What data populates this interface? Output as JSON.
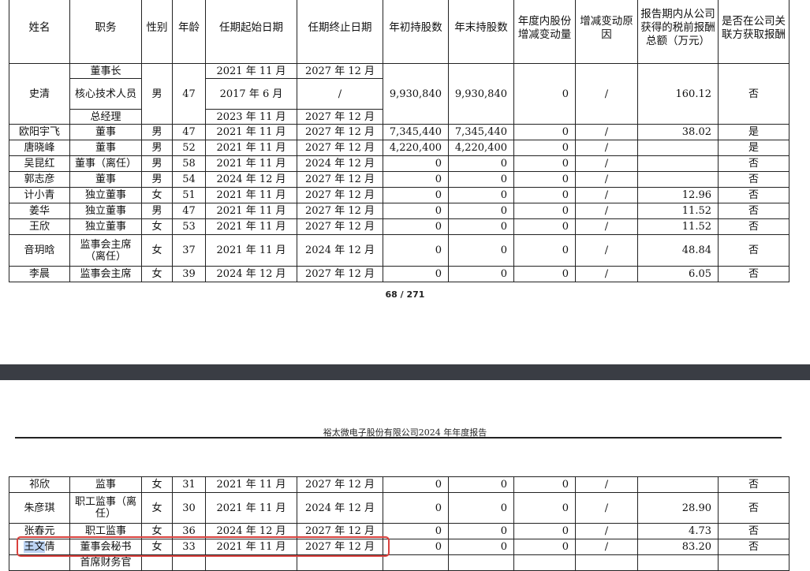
{
  "headers": [
    "姓名",
    "职务",
    "性别",
    "年龄",
    "任期起始日期",
    "任期终止日期",
    "年初持股数",
    "年末持股数",
    "年度内股份增减变动量",
    "增减变动原因",
    "报告期内从公司获得的税前报酬总额（万元）",
    "是否在公司关联方获取报酬"
  ],
  "top_rows": [
    {
      "name": "史清",
      "roles": [
        "董事长",
        "核心技术人员",
        "总经理"
      ],
      "gender": "男",
      "age": "47",
      "starts": [
        "2021 年 11 月",
        "2017 年 6 月",
        "2023 年 11 月"
      ],
      "ends": [
        "2027 年 12 月",
        "/",
        "2027 年 12 月"
      ],
      "begin_shares": "9,930,840",
      "end_shares": "9,930,840",
      "change": "0",
      "reason": "/",
      "pay": "160.12",
      "related": "否"
    },
    {
      "name": "欧阳宇飞",
      "role": "董事",
      "gender": "男",
      "age": "47",
      "start": "2021 年 11 月",
      "end": "2027 年 12 月",
      "begin_shares": "7,345,440",
      "end_shares": "7,345,440",
      "change": "0",
      "reason": "/",
      "pay": "38.02",
      "related": "是"
    },
    {
      "name": "唐晓峰",
      "role": "董事",
      "gender": "男",
      "age": "52",
      "start": "2021 年 11 月",
      "end": "2027 年 12 月",
      "begin_shares": "4,220,400",
      "end_shares": "4,220,400",
      "change": "0",
      "reason": "/",
      "pay": "",
      "related": "是"
    },
    {
      "name": "吴昆红",
      "role": "董事（离任）",
      "gender": "男",
      "age": "58",
      "start": "2021 年 11 月",
      "end": "2024 年 12 月",
      "begin_shares": "0",
      "end_shares": "0",
      "change": "0",
      "reason": "/",
      "pay": "",
      "related": "否"
    },
    {
      "name": "郭志彦",
      "role": "董事",
      "gender": "男",
      "age": "54",
      "start": "2024 年 12 月",
      "end": "2027 年 12 月",
      "begin_shares": "0",
      "end_shares": "0",
      "change": "0",
      "reason": "/",
      "pay": "",
      "related": "否"
    },
    {
      "name": "计小青",
      "role": "独立董事",
      "gender": "女",
      "age": "51",
      "start": "2021 年 11 月",
      "end": "2027 年 12 月",
      "begin_shares": "0",
      "end_shares": "0",
      "change": "0",
      "reason": "/",
      "pay": "12.96",
      "related": "否"
    },
    {
      "name": "姜华",
      "role": "独立董事",
      "gender": "男",
      "age": "47",
      "start": "2021 年 11 月",
      "end": "2027 年 12 月",
      "begin_shares": "0",
      "end_shares": "0",
      "change": "0",
      "reason": "/",
      "pay": "11.52",
      "related": "否"
    },
    {
      "name": "王欣",
      "role": "独立董事",
      "gender": "女",
      "age": "53",
      "start": "2021 年 11 月",
      "end": "2027 年 12 月",
      "begin_shares": "0",
      "end_shares": "0",
      "change": "0",
      "reason": "/",
      "pay": "11.52",
      "related": "否"
    },
    {
      "name": "音玥晗",
      "role": "监事会主席（离任）",
      "gender": "女",
      "age": "37",
      "start": "2021 年 11 月",
      "end": "2024 年 12 月",
      "begin_shares": "0",
      "end_shares": "0",
      "change": "0",
      "reason": "/",
      "pay": "48.84",
      "related": "否"
    },
    {
      "name": "李晨",
      "role": "监事会主席",
      "gender": "女",
      "age": "39",
      "start": "2024 年 12 月",
      "end": "2027 年 12 月",
      "begin_shares": "0",
      "end_shares": "0",
      "change": "0",
      "reason": "/",
      "pay": "6.05",
      "related": "否"
    }
  ],
  "page_number": "68 / 271",
  "report_header": "裕太微电子股份有限公司2024 年年度报告",
  "bottom_rows": [
    {
      "name": "祁欣",
      "role": "监事",
      "gender": "女",
      "age": "31",
      "start": "2021 年 11 月",
      "end": "2027 年 12 月",
      "begin_shares": "0",
      "end_shares": "0",
      "change": "0",
      "reason": "/",
      "pay": "",
      "related": "否"
    },
    {
      "name": "朱彦琪",
      "role": "职工监事（离任）",
      "gender": "女",
      "age": "30",
      "start": "2021 年 11 月",
      "end": "2024 年 12 月",
      "begin_shares": "0",
      "end_shares": "0",
      "change": "0",
      "reason": "/",
      "pay": "28.90",
      "related": "否"
    },
    {
      "name": "张春元",
      "role": "职工监事",
      "gender": "女",
      "age": "36",
      "start": "2024 年 12 月",
      "end": "2027 年 12 月",
      "begin_shares": "0",
      "end_shares": "0",
      "change": "0",
      "reason": "/",
      "pay": "4.73",
      "related": "否"
    },
    {
      "name_sel": "王文",
      "name_rest": "倩",
      "role": "董事会秘书",
      "gender": "女",
      "age": "33",
      "start": "2021 年 11 月",
      "end": "2027 年 12 月",
      "begin_shares": "0",
      "end_shares": "0",
      "change": "0",
      "reason": "/",
      "pay": "83.20",
      "related": "否"
    },
    {
      "name": "",
      "role": "首席财务官",
      "gender": "",
      "age": "",
      "start": "",
      "end": "",
      "begin_shares": "",
      "end_shares": "",
      "change": "",
      "reason": "",
      "pay": "",
      "related": ""
    }
  ],
  "colors": {
    "highlight_box": "#d9413d",
    "selection": "#bcd3f3",
    "viewer_gap": "#3a3d44"
  }
}
